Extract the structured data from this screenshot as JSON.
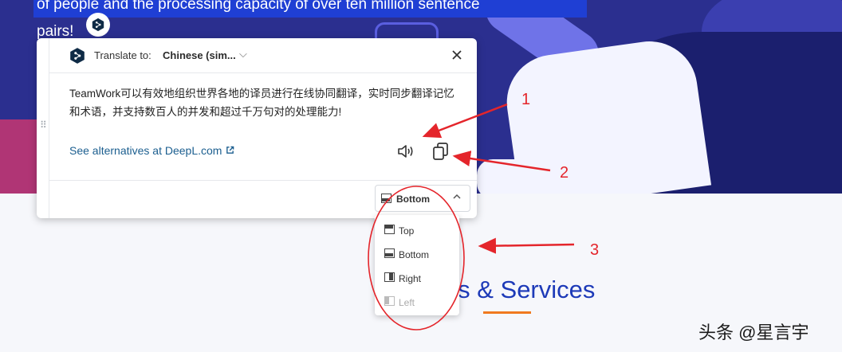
{
  "hero": {
    "line1": "of people and the processing capacity of over ten million sentence",
    "line2": "pairs!"
  },
  "section": {
    "title": "cts & Services"
  },
  "panel": {
    "translate_label": "Translate to:",
    "language": "Chinese (sim...",
    "translated_text": "TeamWork可以有效地组织世界各地的译员进行在线协同翻译，实时同步翻译记忆和术语，并支持数百人的并发和超过千万句对的处理能力!",
    "alternatives_link": "See alternatives at DeepL.com",
    "position_selected": "Bottom"
  },
  "dropdown": {
    "options": [
      {
        "label": "Top",
        "disabled": false
      },
      {
        "label": "Bottom",
        "disabled": false
      },
      {
        "label": "Right",
        "disabled": false
      },
      {
        "label": "Left",
        "disabled": true
      }
    ]
  },
  "annotations": {
    "labels": [
      "1",
      "2",
      "3"
    ]
  },
  "watermark": "头条 @星言宇",
  "colors": {
    "hero_bg": "#2b2f8f",
    "hero_highlight": "#1f3fd4",
    "link": "#1b5e8f",
    "annotation_red": "#e4252b",
    "section_title": "#1d3ab8",
    "underline_orange": "#f07a1f"
  },
  "icons": {
    "logo": "deepl-logo-icon",
    "close": "close-icon",
    "speak": "speaker-icon",
    "copy": "copy-icon",
    "external": "external-link-icon",
    "chevron": "chevron-icon",
    "drag": "drag-handle-icon"
  }
}
